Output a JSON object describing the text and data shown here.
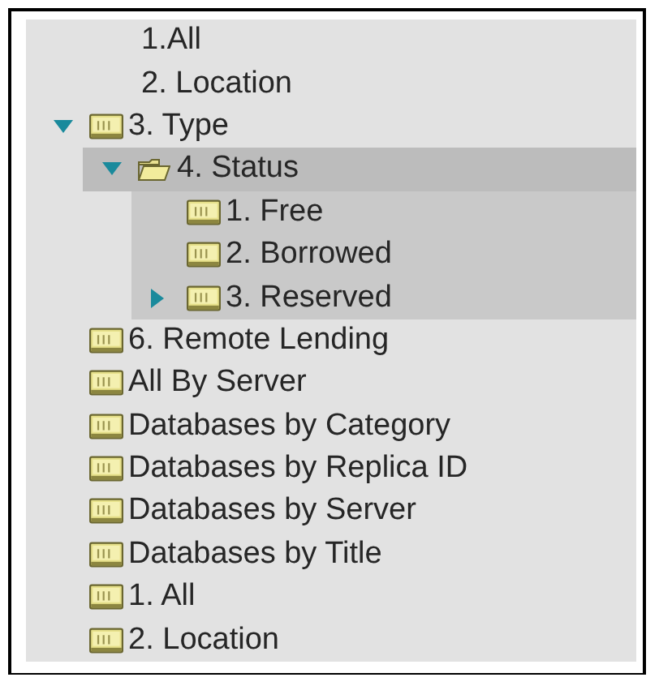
{
  "tree": {
    "items": [
      {
        "label": "1.All",
        "kind": "text",
        "selected": false
      },
      {
        "label": "2. Location",
        "kind": "text",
        "selected": false
      },
      {
        "label": "3. Type",
        "kind": "view",
        "selected": false,
        "expanded": true,
        "children": [
          {
            "label": "4. Status",
            "kind": "folder",
            "selected": true,
            "expanded": true,
            "children": [
              {
                "label": "1. Free",
                "kind": "view",
                "selected": false
              },
              {
                "label": "2. Borrowed",
                "kind": "view",
                "selected": false
              },
              {
                "label": "3. Reserved",
                "kind": "view",
                "selected": false,
                "expanded": false
              }
            ]
          }
        ]
      },
      {
        "label": "6. Remote Lending",
        "kind": "view",
        "selected": false
      },
      {
        "label": "All By Server",
        "kind": "view",
        "selected": false
      },
      {
        "label": "Databases by Category",
        "kind": "view",
        "selected": false
      },
      {
        "label": "Databases by Replica ID",
        "kind": "view",
        "selected": false
      },
      {
        "label": "Databases by Server",
        "kind": "view",
        "selected": false
      },
      {
        "label": "Databases by Title",
        "kind": "view",
        "selected": false
      },
      {
        "label": "1. All",
        "kind": "view",
        "selected": false
      },
      {
        "label": "2. Location",
        "kind": "view",
        "selected": false
      }
    ]
  }
}
